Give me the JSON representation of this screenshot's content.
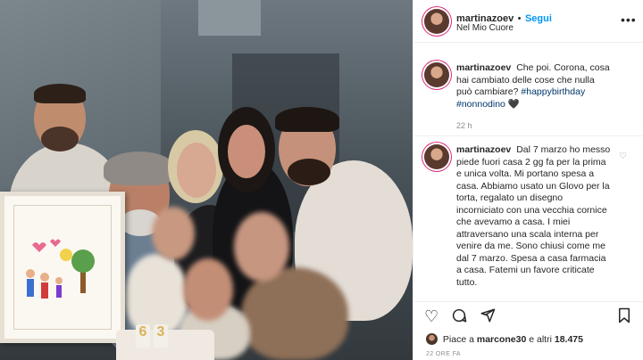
{
  "post": {
    "username": "martinazoev",
    "separator": "•",
    "follow_label": "Segui",
    "location": "Nel Mio Cuore",
    "more_icon": "more-horizontal-icon"
  },
  "caption": {
    "username": "martinazoev",
    "text": "Che poi. Corona, cosa hai cambiato delle cose che nulla può cambiare?",
    "hashtags": "#happybirthday #nonnodino",
    "emoji": "🖤",
    "time": "22 h"
  },
  "comment": {
    "username": "martinazoev",
    "text": "Dal 7 marzo ho messo piede fuori casa 2 gg fa per la prima e unica volta. Mi portano spesa a casa. Abbiamo usato un Glovo per la torta, regalato un disegno incorniciato con una vecchia cornice che avevamo a casa. I miei attraversano una scala interna per venire da me. Sono chiusi come me dal 7 marzo. Spesa a casa farmacia a casa. Fatemi un favore criticate tutto."
  },
  "actions": {
    "like_icon": "heart-outline-icon",
    "comment_icon": "comment-bubble-icon",
    "share_icon": "paper-plane-icon",
    "save_icon": "bookmark-icon"
  },
  "likes": {
    "prefix": "Piace a",
    "user": "marcone30",
    "middle": "e altri",
    "count": "18.475"
  },
  "date": "22 ORE FA",
  "photo": {
    "candles": "63",
    "colors": {
      "background": "#4b565d",
      "frame": "#fbf8f1"
    }
  },
  "colors": {
    "accent": "#0095f6",
    "hashtag": "#00376b",
    "muted": "#8e8e8e"
  }
}
